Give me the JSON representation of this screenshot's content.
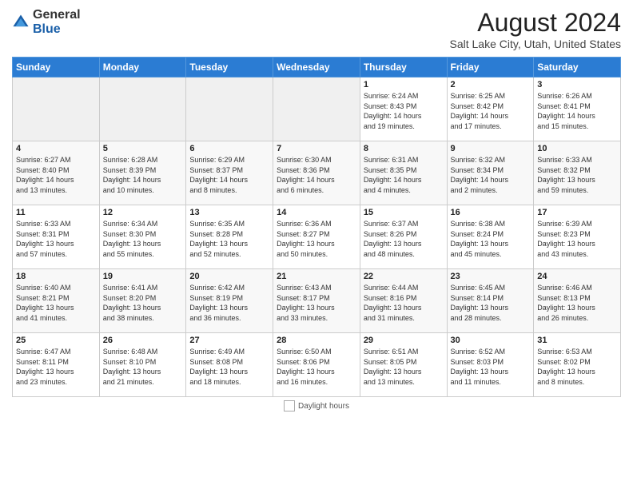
{
  "header": {
    "logo_general": "General",
    "logo_blue": "Blue",
    "month_title": "August 2024",
    "location": "Salt Lake City, Utah, United States"
  },
  "weekdays": [
    "Sunday",
    "Monday",
    "Tuesday",
    "Wednesday",
    "Thursday",
    "Friday",
    "Saturday"
  ],
  "weeks": [
    [
      {
        "day": "",
        "info": ""
      },
      {
        "day": "",
        "info": ""
      },
      {
        "day": "",
        "info": ""
      },
      {
        "day": "",
        "info": ""
      },
      {
        "day": "1",
        "info": "Sunrise: 6:24 AM\nSunset: 8:43 PM\nDaylight: 14 hours\nand 19 minutes."
      },
      {
        "day": "2",
        "info": "Sunrise: 6:25 AM\nSunset: 8:42 PM\nDaylight: 14 hours\nand 17 minutes."
      },
      {
        "day": "3",
        "info": "Sunrise: 6:26 AM\nSunset: 8:41 PM\nDaylight: 14 hours\nand 15 minutes."
      }
    ],
    [
      {
        "day": "4",
        "info": "Sunrise: 6:27 AM\nSunset: 8:40 PM\nDaylight: 14 hours\nand 13 minutes."
      },
      {
        "day": "5",
        "info": "Sunrise: 6:28 AM\nSunset: 8:39 PM\nDaylight: 14 hours\nand 10 minutes."
      },
      {
        "day": "6",
        "info": "Sunrise: 6:29 AM\nSunset: 8:37 PM\nDaylight: 14 hours\nand 8 minutes."
      },
      {
        "day": "7",
        "info": "Sunrise: 6:30 AM\nSunset: 8:36 PM\nDaylight: 14 hours\nand 6 minutes."
      },
      {
        "day": "8",
        "info": "Sunrise: 6:31 AM\nSunset: 8:35 PM\nDaylight: 14 hours\nand 4 minutes."
      },
      {
        "day": "9",
        "info": "Sunrise: 6:32 AM\nSunset: 8:34 PM\nDaylight: 14 hours\nand 2 minutes."
      },
      {
        "day": "10",
        "info": "Sunrise: 6:33 AM\nSunset: 8:32 PM\nDaylight: 13 hours\nand 59 minutes."
      }
    ],
    [
      {
        "day": "11",
        "info": "Sunrise: 6:33 AM\nSunset: 8:31 PM\nDaylight: 13 hours\nand 57 minutes."
      },
      {
        "day": "12",
        "info": "Sunrise: 6:34 AM\nSunset: 8:30 PM\nDaylight: 13 hours\nand 55 minutes."
      },
      {
        "day": "13",
        "info": "Sunrise: 6:35 AM\nSunset: 8:28 PM\nDaylight: 13 hours\nand 52 minutes."
      },
      {
        "day": "14",
        "info": "Sunrise: 6:36 AM\nSunset: 8:27 PM\nDaylight: 13 hours\nand 50 minutes."
      },
      {
        "day": "15",
        "info": "Sunrise: 6:37 AM\nSunset: 8:26 PM\nDaylight: 13 hours\nand 48 minutes."
      },
      {
        "day": "16",
        "info": "Sunrise: 6:38 AM\nSunset: 8:24 PM\nDaylight: 13 hours\nand 45 minutes."
      },
      {
        "day": "17",
        "info": "Sunrise: 6:39 AM\nSunset: 8:23 PM\nDaylight: 13 hours\nand 43 minutes."
      }
    ],
    [
      {
        "day": "18",
        "info": "Sunrise: 6:40 AM\nSunset: 8:21 PM\nDaylight: 13 hours\nand 41 minutes."
      },
      {
        "day": "19",
        "info": "Sunrise: 6:41 AM\nSunset: 8:20 PM\nDaylight: 13 hours\nand 38 minutes."
      },
      {
        "day": "20",
        "info": "Sunrise: 6:42 AM\nSunset: 8:19 PM\nDaylight: 13 hours\nand 36 minutes."
      },
      {
        "day": "21",
        "info": "Sunrise: 6:43 AM\nSunset: 8:17 PM\nDaylight: 13 hours\nand 33 minutes."
      },
      {
        "day": "22",
        "info": "Sunrise: 6:44 AM\nSunset: 8:16 PM\nDaylight: 13 hours\nand 31 minutes."
      },
      {
        "day": "23",
        "info": "Sunrise: 6:45 AM\nSunset: 8:14 PM\nDaylight: 13 hours\nand 28 minutes."
      },
      {
        "day": "24",
        "info": "Sunrise: 6:46 AM\nSunset: 8:13 PM\nDaylight: 13 hours\nand 26 minutes."
      }
    ],
    [
      {
        "day": "25",
        "info": "Sunrise: 6:47 AM\nSunset: 8:11 PM\nDaylight: 13 hours\nand 23 minutes."
      },
      {
        "day": "26",
        "info": "Sunrise: 6:48 AM\nSunset: 8:10 PM\nDaylight: 13 hours\nand 21 minutes."
      },
      {
        "day": "27",
        "info": "Sunrise: 6:49 AM\nSunset: 8:08 PM\nDaylight: 13 hours\nand 18 minutes."
      },
      {
        "day": "28",
        "info": "Sunrise: 6:50 AM\nSunset: 8:06 PM\nDaylight: 13 hours\nand 16 minutes."
      },
      {
        "day": "29",
        "info": "Sunrise: 6:51 AM\nSunset: 8:05 PM\nDaylight: 13 hours\nand 13 minutes."
      },
      {
        "day": "30",
        "info": "Sunrise: 6:52 AM\nSunset: 8:03 PM\nDaylight: 13 hours\nand 11 minutes."
      },
      {
        "day": "31",
        "info": "Sunrise: 6:53 AM\nSunset: 8:02 PM\nDaylight: 13 hours\nand 8 minutes."
      }
    ]
  ],
  "footer": {
    "legend_label": "Daylight hours"
  }
}
